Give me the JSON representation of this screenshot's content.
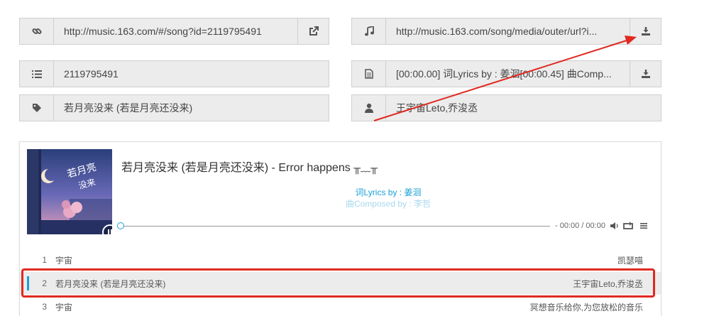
{
  "fields": {
    "song_url": "http://music.163.com/#/song?id=2119795491",
    "media_url": "http://music.163.com/song/media/outer/url?i...",
    "song_id": "2119795491",
    "lyrics": "[00:00.00] 词Lyrics by : 姜洄[00:00.45] 曲Comp...",
    "song_name": "若月亮没来 (若是月亮还没来)",
    "artist": "王宇宙Leto,乔浚丞"
  },
  "icons": {
    "link": "link-icon",
    "music": "music-note-icon",
    "list": "ordered-list-icon",
    "file": "file-text-icon",
    "tag": "tag-icon",
    "user": "user-icon",
    "external": "external-link-icon",
    "download": "download-icon"
  },
  "player": {
    "title": "若月亮没来 (若是月亮还没来) - Error happens",
    "error_face": "╥﹏╥",
    "lyric_line1": "词Lyrics by : 姜洄",
    "lyric_line2": "曲Composed by : 李哲",
    "time": "- 00:00 / 00:00",
    "playlist": [
      {
        "num": "1",
        "name": "宇宙",
        "artist": "凯瑟喵"
      },
      {
        "num": "2",
        "name": "若月亮没来 (若是月亮还没来)",
        "artist": "王宇宙Leto,乔浚丞"
      },
      {
        "num": "3",
        "name": "宇宙",
        "artist": "冥想音乐给你,为您放松的音乐"
      }
    ]
  },
  "colors": {
    "accent": "#1aa0d8",
    "annotation_red": "#e0291f"
  }
}
